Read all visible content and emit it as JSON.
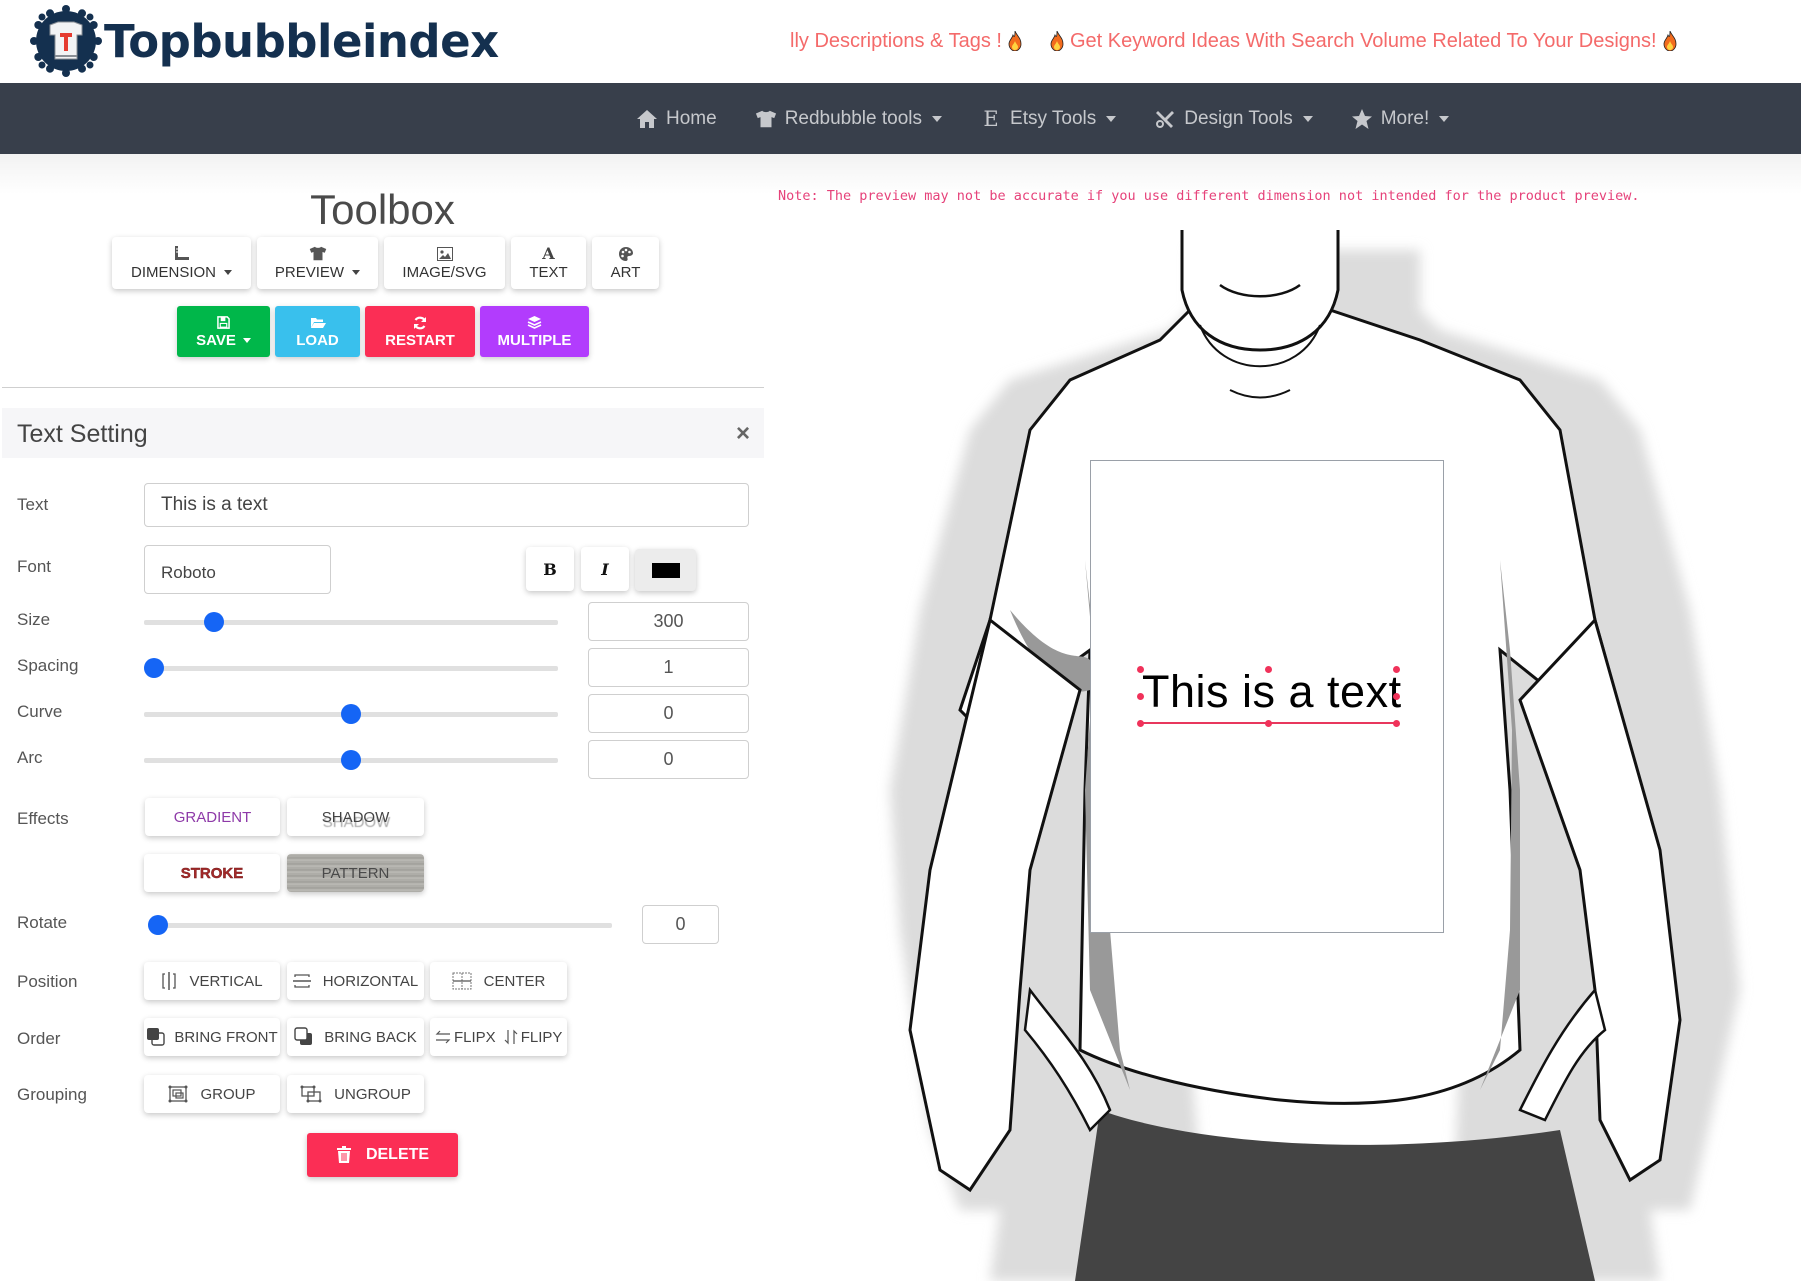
{
  "brand": {
    "name": "Topbubbleindex",
    "badge_letter": "T",
    "colors": {
      "navy": "#14304f",
      "red": "#e53b30"
    }
  },
  "ticker": {
    "items": [
      "lly Descriptions & Tags !",
      "Get Keyword Ideas With Search Volume Related To Your Designs!"
    ],
    "color": "#f46a6a"
  },
  "nav": {
    "items": [
      {
        "label": "Home",
        "icon": "home-icon",
        "dropdown": false
      },
      {
        "label": "Redbubble tools",
        "icon": "tshirt-icon",
        "dropdown": true
      },
      {
        "label": "Etsy Tools",
        "icon": "etsy-icon",
        "dropdown": true
      },
      {
        "label": "Design Tools",
        "icon": "tools-icon",
        "dropdown": true
      },
      {
        "label": "More!",
        "icon": "star-icon",
        "dropdown": true
      }
    ]
  },
  "toolbox": {
    "title": "Toolbox",
    "row1": [
      {
        "label": "DIMENSION",
        "icon": "ruler-icon",
        "dropdown": true
      },
      {
        "label": "PREVIEW",
        "icon": "tshirt-icon",
        "dropdown": true
      },
      {
        "label": "IMAGE/SVG",
        "icon": "image-icon",
        "dropdown": false
      },
      {
        "label": "TEXT",
        "icon": "font-icon",
        "dropdown": false
      },
      {
        "label": "ART",
        "icon": "palette-icon",
        "dropdown": false
      }
    ],
    "row2": [
      {
        "label": "SAVE",
        "icon": "floppy-icon",
        "dropdown": true,
        "color": "#00b74a"
      },
      {
        "label": "LOAD",
        "icon": "folder-open-icon",
        "dropdown": false,
        "color": "#39c0ed"
      },
      {
        "label": "RESTART",
        "icon": "refresh-icon",
        "dropdown": false,
        "color": "#fb2e55"
      },
      {
        "label": "MULTIPLE",
        "icon": "layers-icon",
        "dropdown": false,
        "color": "#b23cfd"
      }
    ]
  },
  "text_setting": {
    "title": "Text Setting",
    "close": "×",
    "labels": {
      "text": "Text",
      "font": "Font",
      "size": "Size",
      "spacing": "Spacing",
      "curve": "Curve",
      "arc": "Arc",
      "effects": "Effects",
      "rotate": "Rotate",
      "position": "Position",
      "order": "Order",
      "grouping": "Grouping"
    },
    "text_value": "This is a text",
    "font_value": "Roboto",
    "format": {
      "bold": "B",
      "italic": "I",
      "color": "#000000"
    },
    "sliders": {
      "size": {
        "value": "300",
        "fraction": 0.17
      },
      "spacing": {
        "value": "1",
        "fraction": 0.0
      },
      "curve": {
        "value": "0",
        "fraction": 0.5
      },
      "arc": {
        "value": "0",
        "fraction": 0.5
      },
      "rotate": {
        "value": "0",
        "fraction": 0.0
      }
    },
    "effects": {
      "gradient": "GRADIENT",
      "shadow": "SHADOW",
      "stroke": "STROKE",
      "pattern": "PATTERN"
    },
    "position_buttons": [
      "VERTICAL",
      "HORIZONTAL",
      "CENTER"
    ],
    "order_buttons": {
      "bring_front": "BRING FRONT",
      "bring_back": "BRING BACK",
      "flipx": "FLIPX",
      "flipy": "FLIPY"
    },
    "grouping_buttons": [
      "GROUP",
      "UNGROUP"
    ],
    "delete": "DELETE"
  },
  "preview": {
    "note": "Note: The preview may not be accurate if you use different dimension not intended for the product preview.",
    "canvas_text": "This is a text",
    "selection_color": "#f0325a"
  }
}
